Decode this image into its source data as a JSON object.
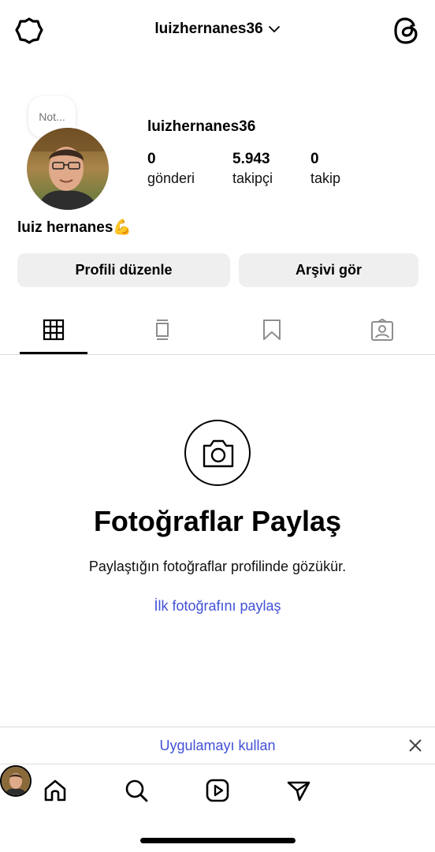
{
  "topbar": {
    "username": "luizhernanes36",
    "settings_icon": "settings-gear-icon",
    "threads_icon": "threads-icon"
  },
  "profile": {
    "note_placeholder": "Not...",
    "username": "luizhernanes36",
    "stats": [
      {
        "value": "0",
        "label": "gönderi"
      },
      {
        "value": "5.943",
        "label": "takipçi"
      },
      {
        "value": "0",
        "label": "takip"
      }
    ],
    "bio_name": "luiz hernanes💪"
  },
  "buttons": {
    "edit_profile": "Profili düzenle",
    "view_archive": "Arşivi gör"
  },
  "tabs": [
    {
      "icon": "grid-icon",
      "active": true
    },
    {
      "icon": "feed-icon",
      "active": false
    },
    {
      "icon": "bookmark-icon",
      "active": false
    },
    {
      "icon": "tagged-icon",
      "active": false
    }
  ],
  "empty_state": {
    "icon": "camera-icon",
    "title": "Fotoğraflar Paylaş",
    "subtitle": "Paylaştığın fotoğraflar profilinde gözükür.",
    "link": "İlk fotoğrafını paylaş"
  },
  "app_banner": {
    "link": "Uygulamayı kullan"
  },
  "bottom_nav": [
    "home-icon",
    "search-icon",
    "reels-icon",
    "direct-icon",
    "profile-avatar"
  ],
  "colors": {
    "link_blue": "#4150d6",
    "button_bg": "#efefef",
    "divider": "#dbdbdb"
  }
}
